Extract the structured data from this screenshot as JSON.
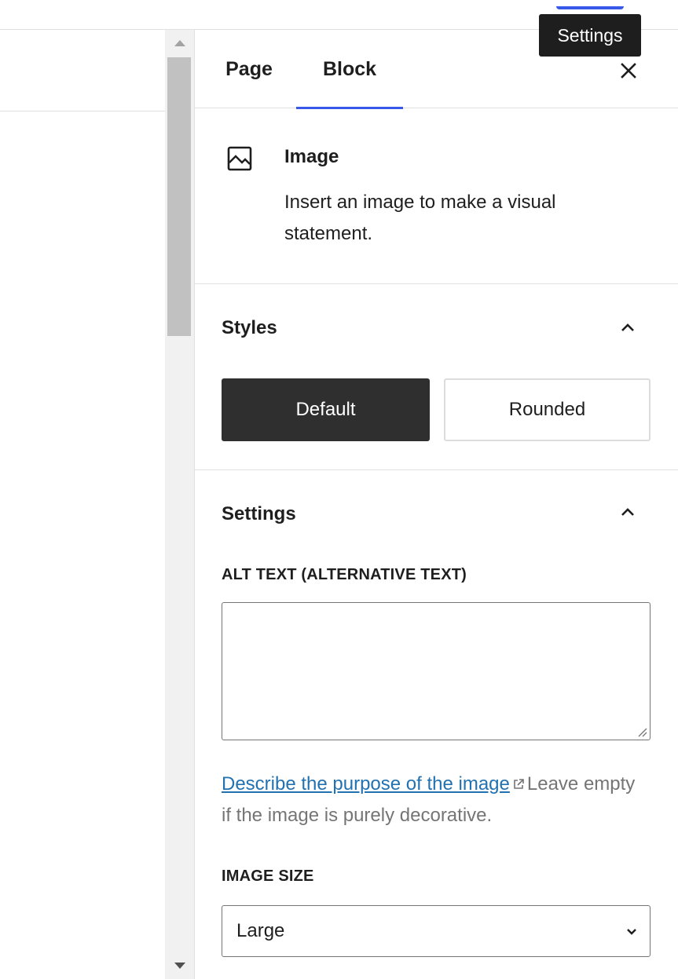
{
  "header": {
    "tooltip": "Settings"
  },
  "sidebar": {
    "tabs": [
      {
        "label": "Page",
        "active": false
      },
      {
        "label": "Block",
        "active": true
      }
    ],
    "close_icon": "close-icon"
  },
  "block": {
    "icon": "image-icon",
    "title": "Image",
    "description": "Insert an image to make a visual statement."
  },
  "styles_panel": {
    "title": "Styles",
    "expanded": true,
    "options": [
      {
        "label": "Default",
        "selected": true
      },
      {
        "label": "Rounded",
        "selected": false
      }
    ]
  },
  "settings_panel": {
    "title": "Settings",
    "expanded": true,
    "alt_text": {
      "label": "ALT TEXT (ALTERNATIVE TEXT)",
      "value": "",
      "help_link": "Describe the purpose of the image",
      "help_suffix": "Leave empty if the image is purely decorative."
    },
    "image_size": {
      "label": "IMAGE SIZE",
      "value": "Large"
    }
  },
  "colors": {
    "accent": "#3858e9",
    "link": "#2271b1",
    "dark_button": "#2f2f2f"
  }
}
